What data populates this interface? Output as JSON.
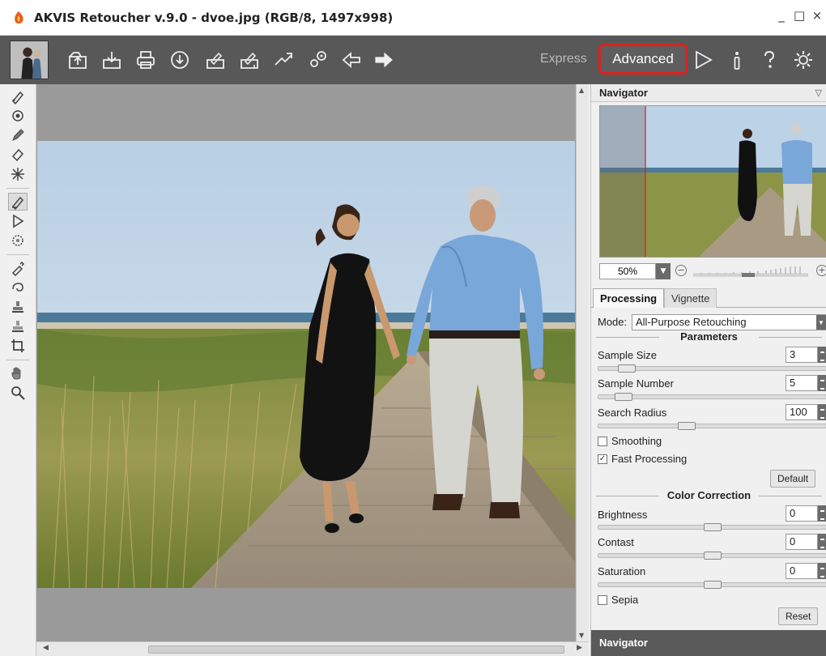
{
  "window": {
    "title": "AKVIS Retoucher v.9.0 - dvoe.jpg (RGB/8, 1497x998)",
    "controls": [
      "_",
      "□",
      "×"
    ]
  },
  "toolbar": {
    "buttons": [
      {
        "name": "open-icon"
      },
      {
        "name": "save-icon"
      },
      {
        "name": "print-icon"
      },
      {
        "name": "share-icon"
      },
      {
        "name": "load-strokes-icon"
      },
      {
        "name": "save-strokes-icon"
      },
      {
        "name": "batch-icon"
      },
      {
        "name": "settings-gear-icon"
      },
      {
        "name": "undo-arrow-icon"
      },
      {
        "name": "redo-arrow-icon"
      }
    ],
    "mode_express": "Express",
    "mode_advanced": "Advanced",
    "right_icons": [
      "run-icon",
      "info-icon",
      "help-icon",
      "preferences-icon"
    ]
  },
  "left_tools": [
    "retouch-brush-icon",
    "eye-icon",
    "pencil-icon",
    "eraser-icon",
    "magic-wand-icon",
    "selection-brush-icon",
    "play-icon",
    "healing-icon",
    "eyedropper-icon",
    "chameleon-icon",
    "stamp-icon",
    "clone-stamp-icon",
    "crop-icon",
    "hand-icon",
    "zoom-icon"
  ],
  "navigator": {
    "title": "Navigator",
    "zoom": "50%",
    "bottom_title": "Navigator"
  },
  "tabs": {
    "processing": "Processing",
    "vignette": "Vignette"
  },
  "processing": {
    "mode_label": "Mode:",
    "mode_value": "All-Purpose Retouching",
    "parameters_title": "Parameters",
    "sample_size_label": "Sample Size",
    "sample_size_value": "3",
    "sample_number_label": "Sample Number",
    "sample_number_value": "5",
    "search_radius_label": "Search Radius",
    "search_radius_value": "100",
    "smoothing_label": "Smoothing",
    "smoothing_checked": false,
    "fast_processing_label": "Fast Processing",
    "fast_processing_checked": true,
    "default_button": "Default",
    "color_correction_title": "Color Correction",
    "brightness_label": "Brightness",
    "brightness_value": "0",
    "contrast_label": "Contast",
    "contrast_value": "0",
    "saturation_label": "Saturation",
    "saturation_value": "0",
    "sepia_label": "Sepia",
    "sepia_checked": false,
    "reset_button": "Reset"
  },
  "colors": {
    "accent_red": "#e0201c",
    "toolbar_bg": "#585858",
    "canvas_bg": "#9a9a9a"
  }
}
